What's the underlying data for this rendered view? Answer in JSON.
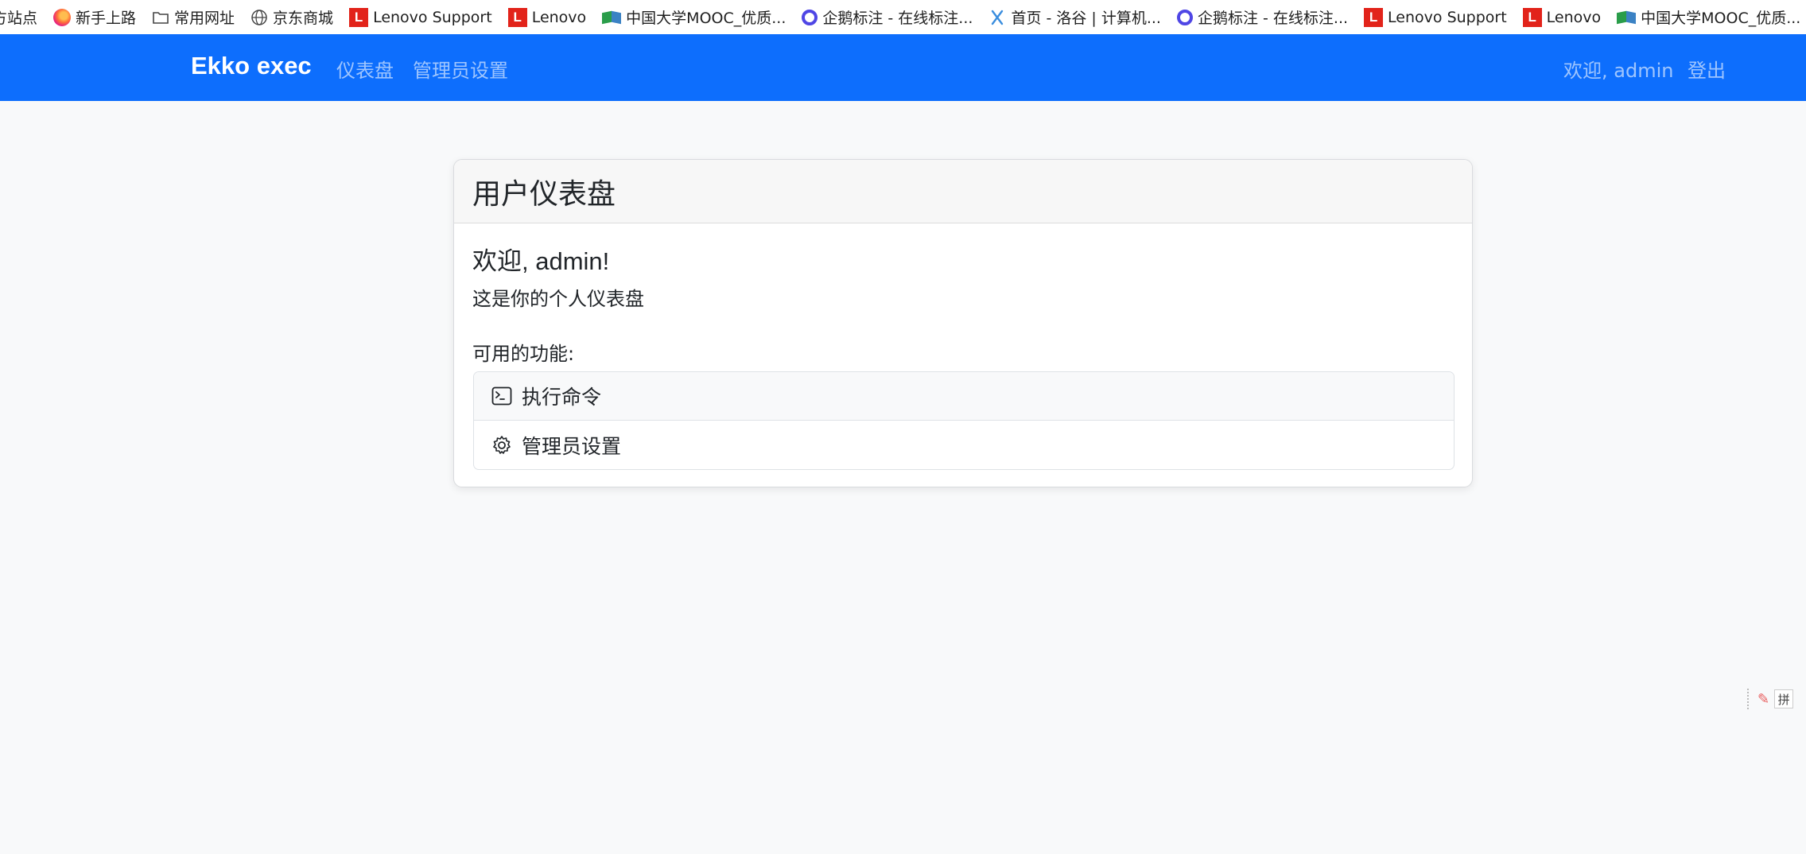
{
  "bookmarks": [
    {
      "label": "方站点",
      "icon": "none"
    },
    {
      "label": "新手上路",
      "icon": "firefox-icon"
    },
    {
      "label": "常用网址",
      "icon": "folder-icon"
    },
    {
      "label": "京东商城",
      "icon": "globe-icon"
    },
    {
      "label": "Lenovo Support",
      "icon": "lenovo-icon"
    },
    {
      "label": "Lenovo",
      "icon": "lenovo-icon"
    },
    {
      "label": "中国大学MOOC_优质...",
      "icon": "mooc-icon"
    },
    {
      "label": "企鹅标注 - 在线标注...",
      "icon": "qie-icon"
    },
    {
      "label": "首页 - 洛谷 | 计算机...",
      "icon": "luogu-icon"
    },
    {
      "label": "企鹅标注 - 在线标注...",
      "icon": "qie-icon"
    },
    {
      "label": "Lenovo Support",
      "icon": "lenovo-icon"
    },
    {
      "label": "Lenovo",
      "icon": "lenovo-icon"
    },
    {
      "label": "中国大学MOOC_优质...",
      "icon": "mooc-icon"
    }
  ],
  "navbar": {
    "brand": "Ekko exec",
    "links": [
      "仪表盘",
      "管理员设置"
    ],
    "welcome": "欢迎, admin",
    "logout": "登出",
    "color": "#0d6efd"
  },
  "card": {
    "title": "用户仪表盘",
    "welcome": "欢迎, admin!",
    "intro": "这是你的个人仪表盘",
    "features_label": "可用的功能:",
    "features": [
      {
        "label": "执行命令",
        "icon": "terminal-icon"
      },
      {
        "label": "管理员设置",
        "icon": "gear-icon"
      }
    ]
  },
  "ime": {
    "mode": "拼"
  }
}
